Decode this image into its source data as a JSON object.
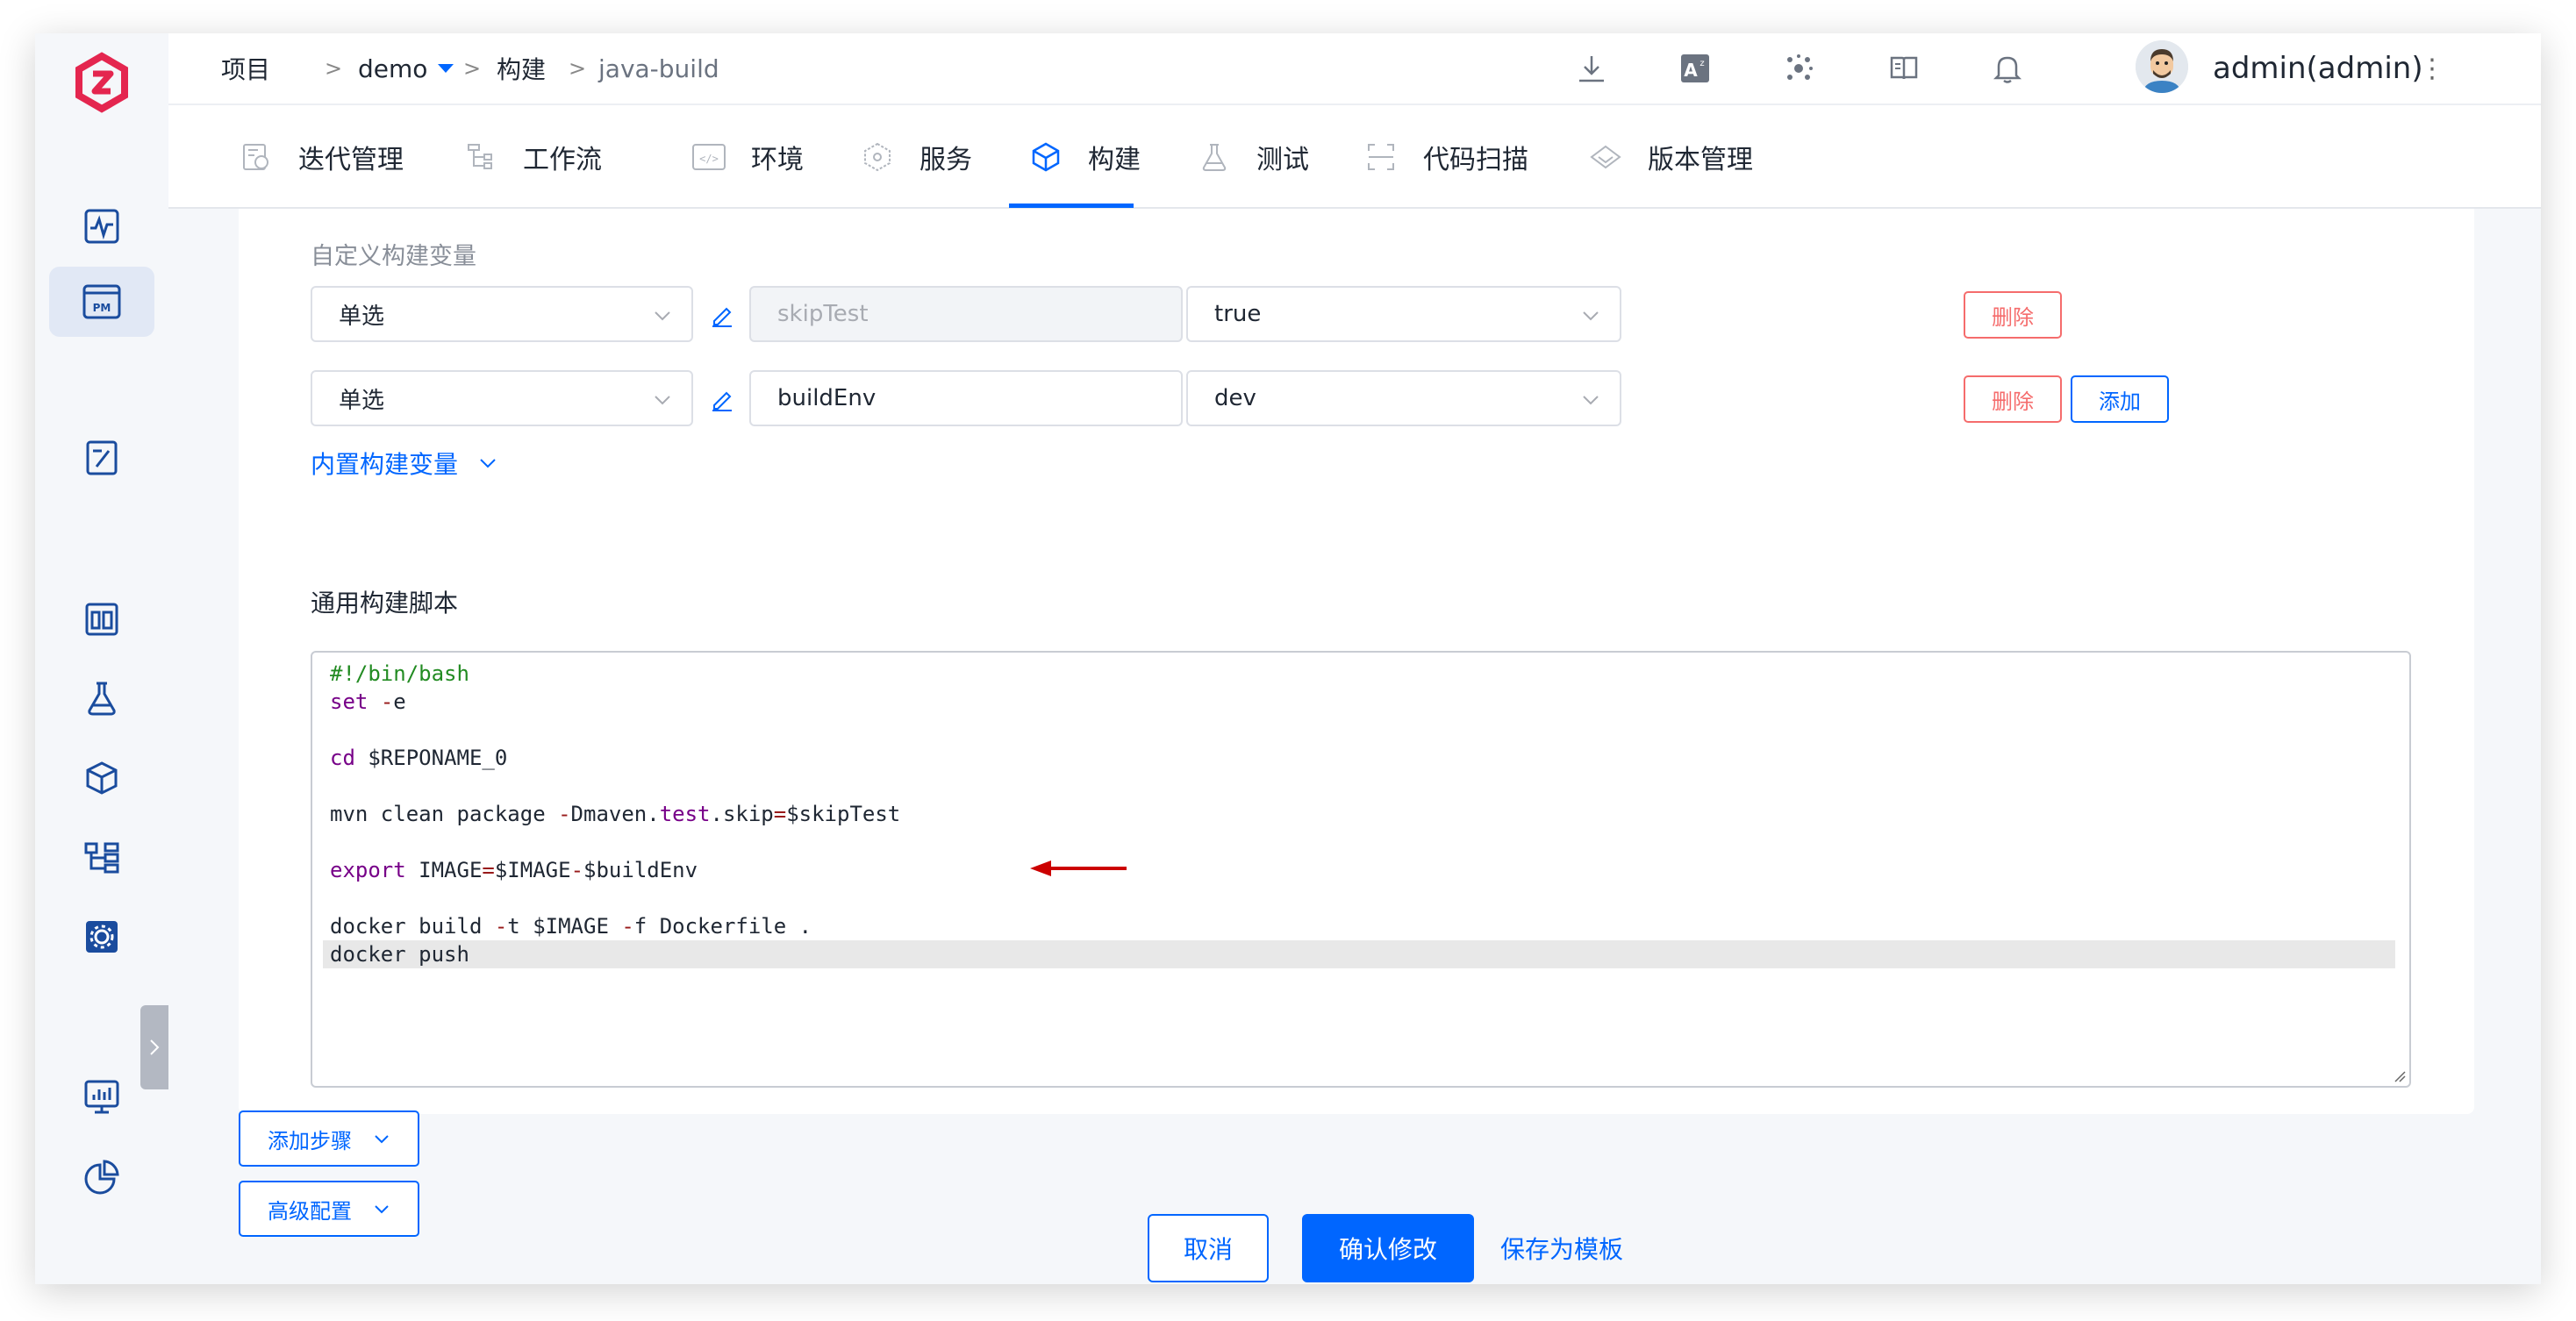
{
  "breadcrumb": {
    "project": "项目",
    "sep": ">",
    "demo": "demo",
    "build": "构建",
    "current": "java-build"
  },
  "header": {
    "icons": [
      "download-icon",
      "translate-icon",
      "network-icon",
      "docs-icon",
      "bell-icon"
    ],
    "username": "admin(admin)"
  },
  "tabs": [
    {
      "label": "迭代管理",
      "icon": "iteration-icon"
    },
    {
      "label": "工作流",
      "icon": "workflow-icon"
    },
    {
      "label": "环境",
      "icon": "environment-icon"
    },
    {
      "label": "服务",
      "icon": "service-icon"
    },
    {
      "label": "构建",
      "icon": "build-icon",
      "active": true
    },
    {
      "label": "测试",
      "icon": "test-icon"
    },
    {
      "label": "代码扫描",
      "icon": "scan-icon"
    },
    {
      "label": "版本管理",
      "icon": "version-icon"
    }
  ],
  "variables": {
    "title": "自定义构建变量",
    "rows": [
      {
        "type": "单选",
        "name": "skipTest",
        "value": "true",
        "name_disabled": true,
        "actions": [
          "删除"
        ]
      },
      {
        "type": "单选",
        "name": "buildEnv",
        "value": "dev",
        "name_disabled": false,
        "actions": [
          "删除",
          "添加"
        ]
      }
    ],
    "builtin_toggle": "内置构建变量"
  },
  "script": {
    "title": "通用构建脚本",
    "lines": [
      "#!/bin/bash",
      "set -e",
      "",
      "cd $REPONAME_0",
      "",
      "mvn clean package -Dmaven.test.skip=$skipTest",
      "",
      "export IMAGE=$IMAGE-$buildEnv",
      "",
      "docker build -t $IMAGE -f Dockerfile .",
      "docker push"
    ]
  },
  "footer": {
    "add_step": "添加步骤",
    "advanced": "高级配置",
    "cancel": "取消",
    "confirm": "确认修改",
    "save_template": "保存为模板"
  },
  "colors": {
    "primary": "#0066ff",
    "danger": "#f56c6c",
    "brand": "#e4264f",
    "arrow": "#cc0000"
  }
}
